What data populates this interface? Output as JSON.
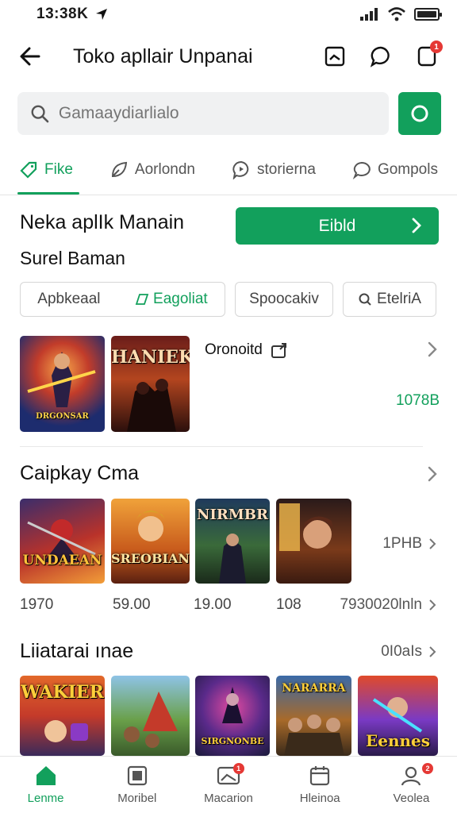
{
  "status_bar": {
    "time": "13:38K"
  },
  "header": {
    "title": "Toko apllair Unpanai",
    "notification_count": "1"
  },
  "search": {
    "placeholder": "Gamaaydiarlialo"
  },
  "tabs": [
    {
      "label": "Fike",
      "active": true
    },
    {
      "label": "Aorlondn",
      "active": false
    },
    {
      "label": "storierna",
      "active": false
    },
    {
      "label": "Gompols",
      "active": false
    }
  ],
  "promo": {
    "title": "Neka aplIk Manain",
    "subtitle": "Surel Baman",
    "button_label": "Eibld"
  },
  "chips": {
    "first_a": "Apbkeaal",
    "first_b": "Eagoliat",
    "second": "Spoocakiv",
    "third": "EtelriA"
  },
  "featured": {
    "name": "Oronoitd",
    "size": "1078B",
    "games": [
      {
        "art_text": "DRGONSAR"
      },
      {
        "art_text": "HANIEK"
      }
    ]
  },
  "section_one": {
    "title": "Caipkay Cma",
    "more_label": "1PHB",
    "games": [
      {
        "art_text": "UNDAEAN",
        "price": "1970"
      },
      {
        "art_text": "SREOBIAN",
        "price": "59.00"
      },
      {
        "art_text": "NIRMBR",
        "price": "19.00"
      },
      {
        "art_text": "",
        "price": "108"
      }
    ],
    "extra_price": "7930020lnln"
  },
  "section_two": {
    "title": "Liiatarai ınae",
    "more_label": "0I0aIs",
    "games": [
      {
        "art_text": "WAKIER"
      },
      {
        "art_text": ""
      },
      {
        "art_text": "SIRGNONBE"
      },
      {
        "art_text": "NARARRA"
      },
      {
        "art_text": "Eennes"
      }
    ]
  },
  "bottom_nav": [
    {
      "label": "Lenme",
      "icon": "home-icon",
      "active": true
    },
    {
      "label": "Moribel",
      "icon": "games-icon",
      "active": false
    },
    {
      "label": "Macarion",
      "icon": "apps-icon",
      "active": false,
      "badge": "1"
    },
    {
      "label": "Hleinoa",
      "icon": "calendar-icon",
      "active": false
    },
    {
      "label": "Veolea",
      "icon": "profile-icon",
      "active": false,
      "badge": "2"
    }
  ],
  "colors": {
    "accent": "#12a05c",
    "badge": "#e53935"
  }
}
